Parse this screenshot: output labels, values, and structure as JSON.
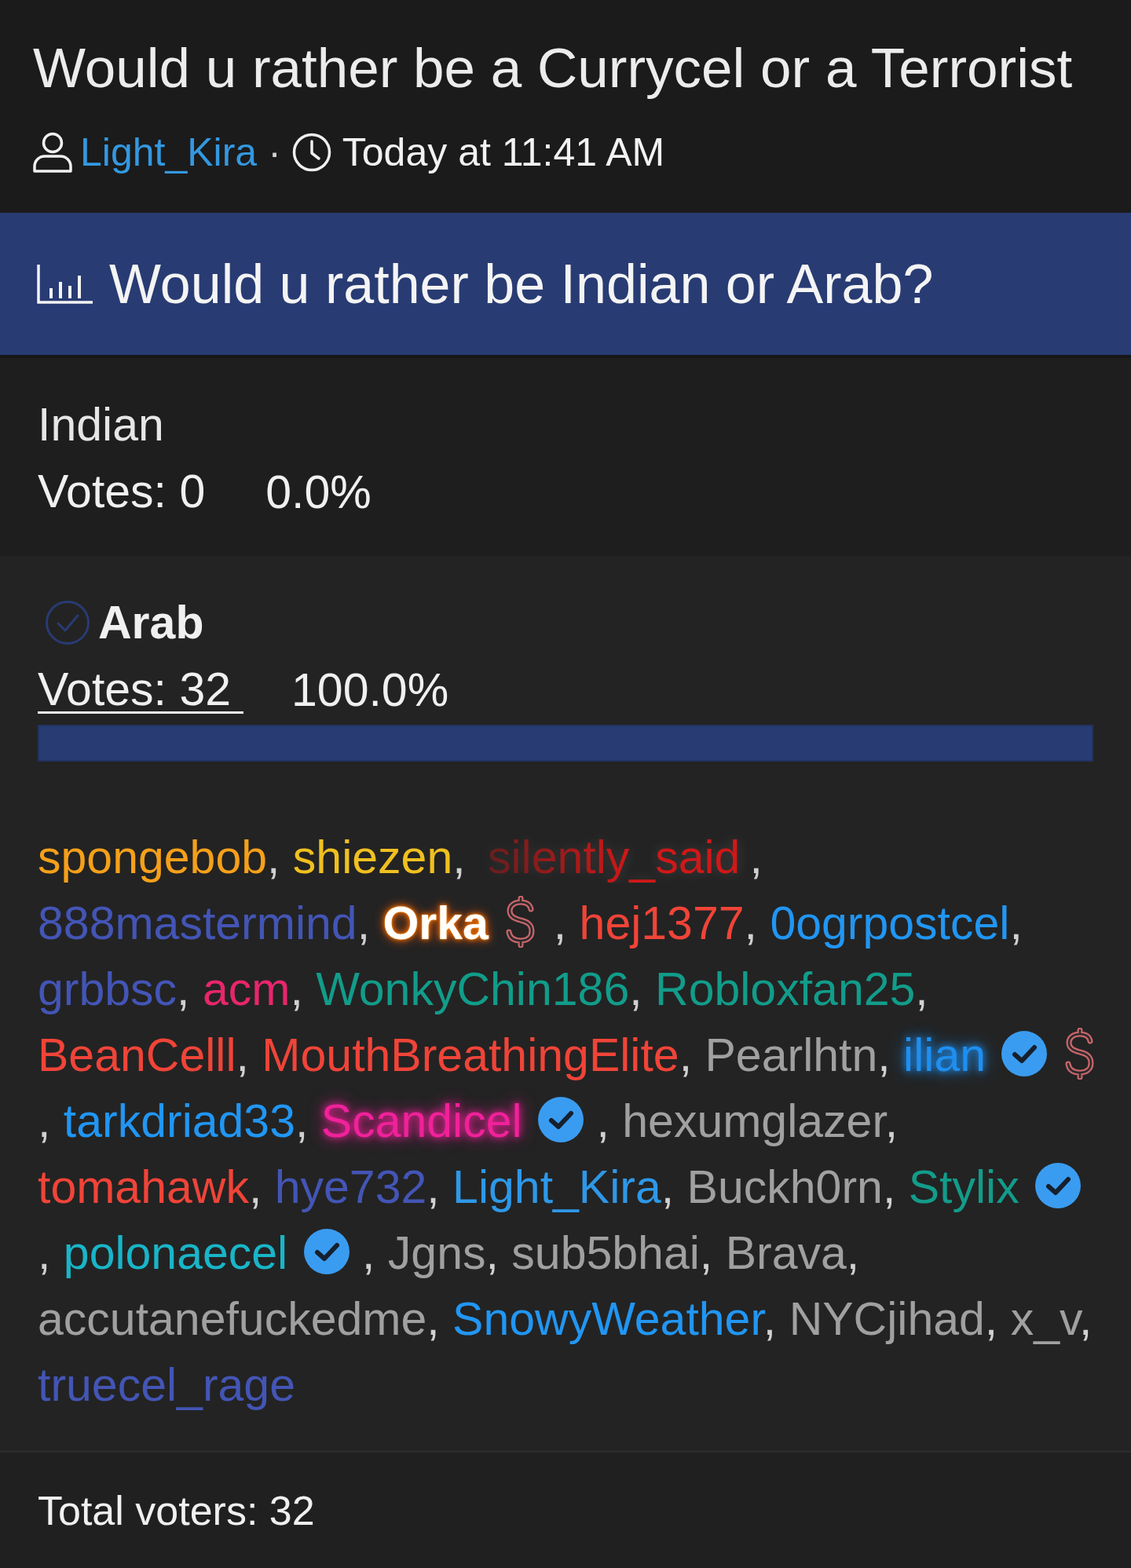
{
  "thread": {
    "title": "Would u rather be a Currycel or a Terrorist",
    "author": "Light_Kira",
    "separator": "·",
    "time": "Today at 11:41 AM"
  },
  "poll": {
    "title": "Would u rather be Indian or Arab?",
    "options": [
      {
        "label": "Indian",
        "votes": "Votes: 0",
        "percent": "0.0%",
        "selected": false
      },
      {
        "label": "Arab",
        "votes": "Votes: 32",
        "percent": "100.0%",
        "selected": true,
        "level": 1,
        "voters": [
          {
            "name": "spongebob",
            "color": "#f5a01a",
            "kind": "plain",
            "verified": false,
            "dollar_badge": false
          },
          {
            "name": "shiezen",
            "color": "#f0c020",
            "kind": "plain",
            "verified": false,
            "dollar_badge": false
          },
          {
            "name": "silently_said",
            "color": "#d01818",
            "kind": "fade",
            "verified": false,
            "dollar_badge": false
          },
          {
            "name": "888mastermind",
            "color": "#4355b5",
            "kind": "plain",
            "verified": false,
            "dollar_badge": false
          },
          {
            "name": "Orka",
            "color": "#ffffff",
            "kind": "flame",
            "verified": false,
            "dollar_badge": true
          },
          {
            "name": "hej1377",
            "color": "#f04438",
            "kind": "plain",
            "verified": false,
            "dollar_badge": false
          },
          {
            "name": "0ogrpostcel",
            "color": "#2196f3",
            "kind": "plain",
            "verified": false,
            "dollar_badge": false
          },
          {
            "name": "grbbsc",
            "color": "#4355b5",
            "kind": "plain",
            "verified": false,
            "dollar_badge": false
          },
          {
            "name": "acm",
            "color": "#e8266b",
            "kind": "plain",
            "verified": false,
            "dollar_badge": false
          },
          {
            "name": "WonkyChin186",
            "color": "#129c8a",
            "kind": "plain",
            "verified": false,
            "dollar_badge": false
          },
          {
            "name": "Robloxfan25",
            "color": "#129c8a",
            "kind": "plain",
            "verified": false,
            "dollar_badge": false
          },
          {
            "name": "BeanCelll",
            "color": "#f04438",
            "kind": "plain",
            "verified": false,
            "dollar_badge": false
          },
          {
            "name": "MouthBreathingElite",
            "color": "#f04438",
            "kind": "plain",
            "verified": false,
            "dollar_badge": false
          },
          {
            "name": "Pearlhtn",
            "color": "#a0a0a0",
            "kind": "plain",
            "verified": false,
            "dollar_badge": false
          },
          {
            "name": "ilian",
            "color": "#1e8ff0",
            "kind": "glow",
            "verified": true,
            "dollar_badge": true
          },
          {
            "name": "tarkdriad33",
            "color": "#2196f3",
            "kind": "plain",
            "verified": false,
            "dollar_badge": false
          },
          {
            "name": "Scandicel",
            "color": "#f0219a",
            "kind": "glow",
            "verified": true,
            "dollar_badge": false
          },
          {
            "name": "hexumglazer",
            "color": "#a0a0a0",
            "kind": "plain",
            "verified": false,
            "dollar_badge": false
          },
          {
            "name": "tomahawk",
            "color": "#f04438",
            "kind": "plain",
            "verified": false,
            "dollar_badge": false
          },
          {
            "name": "hye732",
            "color": "#4355b5",
            "kind": "plain",
            "verified": false,
            "dollar_badge": false
          },
          {
            "name": "Light_Kira",
            "color": "#2e98e8",
            "kind": "plain",
            "verified": false,
            "dollar_badge": false
          },
          {
            "name": "Buckh0rn",
            "color": "#a0a0a0",
            "kind": "plain",
            "verified": false,
            "dollar_badge": false
          },
          {
            "name": "Stylix",
            "color": "#129c8a",
            "kind": "plain",
            "verified": true,
            "dollar_badge": false
          },
          {
            "name": "polonaecel",
            "color": "#19b5c8",
            "kind": "plain",
            "verified": true,
            "dollar_badge": false
          },
          {
            "name": "Jgns",
            "color": "#a0a0a0",
            "kind": "plain",
            "verified": false,
            "dollar_badge": false
          },
          {
            "name": "sub5bhai",
            "color": "#a0a0a0",
            "kind": "plain",
            "verified": false,
            "dollar_badge": false
          },
          {
            "name": "Brava",
            "color": "#a0a0a0",
            "kind": "plain",
            "verified": false,
            "dollar_badge": false
          },
          {
            "name": "accutanefuckedme",
            "color": "#a0a0a0",
            "kind": "plain",
            "verified": false,
            "dollar_badge": false
          },
          {
            "name": "SnowyWeather",
            "color": "#2196f3",
            "kind": "plain",
            "verified": false,
            "dollar_badge": false
          },
          {
            "name": "NYCjihad",
            "color": "#a0a0a0",
            "kind": "plain",
            "verified": false,
            "dollar_badge": false
          },
          {
            "name": "x_v",
            "color": "#a0a0a0",
            "kind": "plain",
            "verified": false,
            "dollar_badge": false
          },
          {
            "name": "truecel_rage",
            "color": "#4355b5",
            "kind": "plain",
            "verified": false,
            "dollar_badge": false
          }
        ]
      }
    ],
    "voter_separator": ",",
    "total": "Total voters: 32"
  }
}
